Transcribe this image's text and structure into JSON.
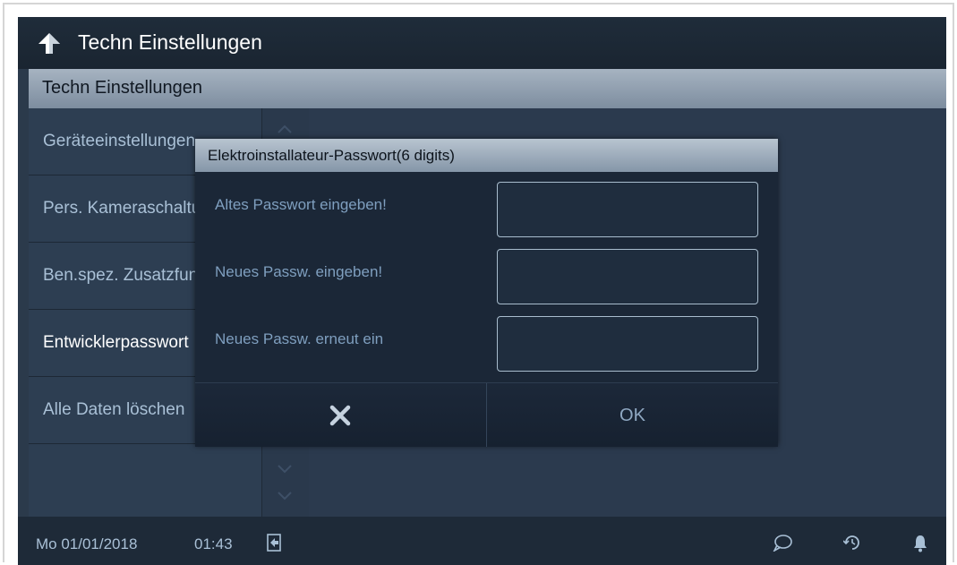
{
  "header": {
    "title": "Techn Einstellungen",
    "back_icon": "back-arrow-icon"
  },
  "section": {
    "title": "Techn Einstellungen"
  },
  "menu": {
    "items": [
      {
        "label": "Geräteeinstellungen"
      },
      {
        "label": "Pers. Kameraschaltung"
      },
      {
        "label": "Ben.spez. Zusatzfunktionen"
      },
      {
        "label": "Entwicklerpasswort",
        "selected": true
      },
      {
        "label": "Alle Daten löschen"
      }
    ]
  },
  "dialog": {
    "title": "Elektroinstallateur-Passwort(6 digits)",
    "fields": [
      {
        "label": "Altes Passwort eingeben!",
        "value": ""
      },
      {
        "label": "Neues Passw. eingeben!",
        "value": ""
      },
      {
        "label": "Neues Passw. erneut ein",
        "value": ""
      }
    ],
    "cancel_icon": "close-icon",
    "ok_label": "OK"
  },
  "status": {
    "date": "Mo 01/01/2018",
    "time": "01:43",
    "icons": [
      "logout-icon",
      "chat-icon",
      "history-icon",
      "bell-icon"
    ]
  },
  "colors": {
    "background": "#2b3a4b",
    "header_bar": "#8d9cad",
    "text_muted": "#a9c0d6",
    "dialog_bg": "#1b2737"
  }
}
